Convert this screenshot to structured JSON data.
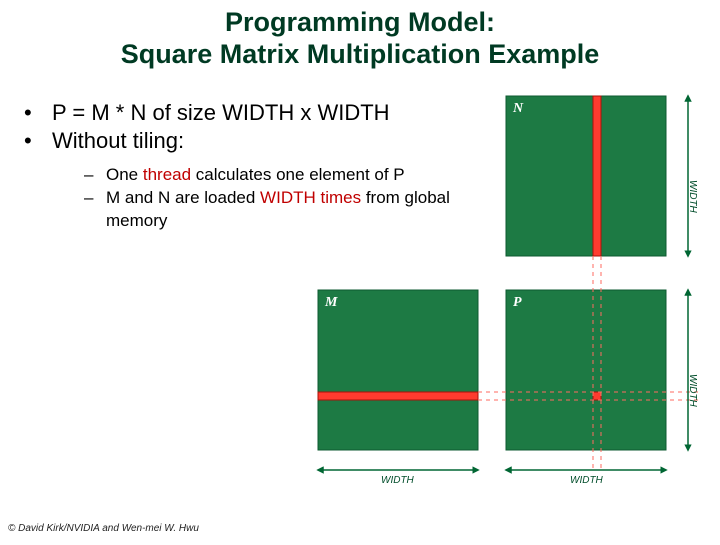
{
  "title": {
    "line1": "Programming Model:",
    "line2": "Square Matrix Multiplication Example"
  },
  "bullets": {
    "b1": "P = M * N of size WIDTH x WIDTH",
    "b2": "Without tiling:",
    "s1a": "One ",
    "s1_hl": "thread",
    "s1b": " calculates one element of P",
    "s2a": "M and N are loaded ",
    "s2_hl": "WIDTH times",
    "s2b": " from global memory"
  },
  "diagram": {
    "N_label": "N",
    "M_label": "M",
    "P_label": "P",
    "width_label": "WIDTH"
  },
  "copyright": "© David Kirk/NVIDIA and Wen-mei W. Hwu"
}
